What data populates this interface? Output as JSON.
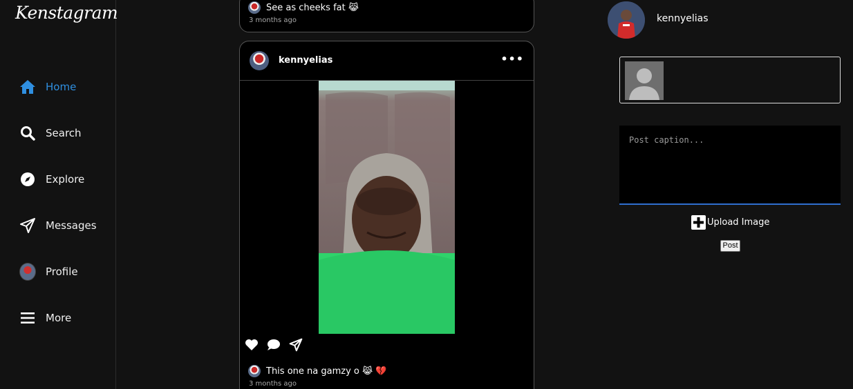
{
  "app": {
    "logo": "Kenstagram",
    "accent_color": "#2f8fe0"
  },
  "sidebar": {
    "items": [
      {
        "label": "Home",
        "icon": "home-icon",
        "active": true
      },
      {
        "label": "Search",
        "icon": "search-icon"
      },
      {
        "label": "Explore",
        "icon": "compass-icon"
      },
      {
        "label": "Messages",
        "icon": "send-icon"
      },
      {
        "label": "Profile",
        "icon": "avatar"
      },
      {
        "label": "More",
        "icon": "menu-icon"
      }
    ]
  },
  "feed": {
    "previous_post": {
      "caption": "See as cheeks fat 😹",
      "time": "3 months ago"
    },
    "post": {
      "username": "kennyelias",
      "menu_icon": "more-dots-icon",
      "caption": "This one na gamzy o 😹 💔",
      "time": "3 months ago"
    }
  },
  "composer": {
    "username": "kennyelias",
    "caption_placeholder": "Post caption...",
    "upload_label": "Upload Image",
    "post_label": "Post"
  }
}
